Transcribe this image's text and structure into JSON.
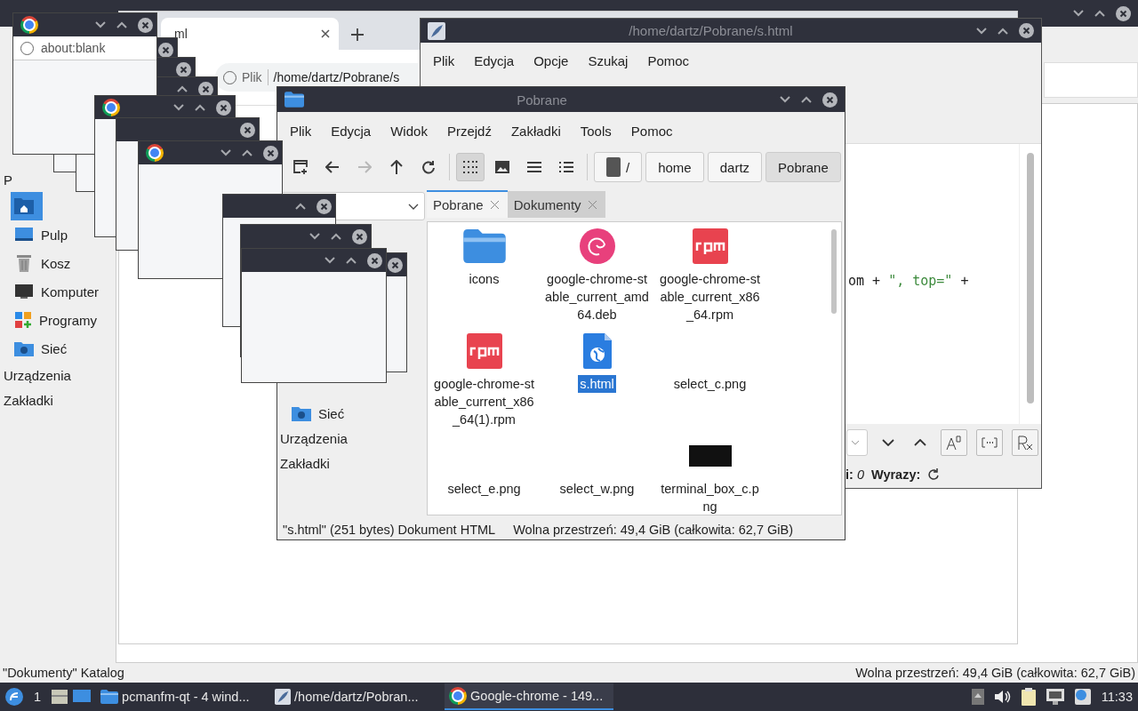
{
  "desktop_file_manager": {
    "sidebar": [
      {
        "kind": "heading",
        "label": "P"
      },
      {
        "kind": "place",
        "selected": true
      },
      {
        "kind": "place",
        "label": "Pulp",
        "selected": false
      },
      {
        "kind": "place",
        "label": "Kosz",
        "selected": false
      },
      {
        "kind": "place",
        "label": "Komputer",
        "selected": false
      },
      {
        "kind": "place",
        "label": "Programy",
        "selected": false
      },
      {
        "kind": "place",
        "label": "Sieć",
        "selected": false
      },
      {
        "kind": "heading",
        "label": "Urządzenia"
      },
      {
        "kind": "heading",
        "label": "Zakładki"
      }
    ],
    "status_left": "\"Dokumenty\" Katalog",
    "status_right": "Wolna przestrzeń: 49,4 GiB (całkowita: 62,7 GiB)"
  },
  "browser_window": {
    "tab_title": "ml",
    "address_scheme": "Plik",
    "address_path": "/home/dartz/Pobrane/s"
  },
  "blank_browser_window": {
    "address": "about:blank"
  },
  "editor_window": {
    "title": "/home/dartz/Pobrane/s.html",
    "menu": [
      "Plik",
      "Edycja",
      "Opcje",
      "Szukaj",
      "Pomoc"
    ],
    "code_tokens": [
      {
        "kind": "plain",
        "text": "om + "
      },
      {
        "kind": "string",
        "text": "\", top=\""
      },
      {
        "kind": "plain",
        "text": " +"
      }
    ],
    "status": [
      {
        "label": "i:",
        "value": "0"
      },
      {
        "label": "Wyrazy:"
      }
    ]
  },
  "file_manager_window": {
    "title": "Pobrane",
    "menu": [
      "Plik",
      "Edycja",
      "Widok",
      "Przejdź",
      "Zakładki",
      "Tools",
      "Pomoc"
    ],
    "toolbar": [
      {
        "selected": false,
        "disabled": false
      },
      {
        "selected": false,
        "disabled": false
      },
      {
        "selected": false,
        "disabled": true
      },
      {
        "selected": false,
        "disabled": false
      },
      {
        "selected": false,
        "disabled": false
      },
      {
        "selected": true,
        "disabled": false
      },
      {
        "selected": false,
        "disabled": false
      },
      {
        "selected": false,
        "disabled": false
      },
      {
        "selected": false,
        "disabled": false
      }
    ],
    "path": [
      {
        "label": "/",
        "selected": false
      },
      {
        "label": "home",
        "selected": false
      },
      {
        "label": "dartz",
        "selected": false
      },
      {
        "label": "Pobrane",
        "selected": true
      }
    ],
    "sidebar": [
      {
        "kind": "place",
        "label": "Sieć"
      },
      {
        "kind": "heading",
        "label": "Urządzenia"
      },
      {
        "kind": "heading",
        "label": "Zakładki"
      }
    ],
    "tabs": [
      {
        "label": "Pobrane",
        "selected": true
      },
      {
        "label": "Dokumenty",
        "selected": false
      }
    ],
    "files": [
      {
        "kind": "folder",
        "name": "icons",
        "selected": false
      },
      {
        "kind": "deb",
        "name": "google-chrome-stable_current_amd64.deb",
        "selected": false
      },
      {
        "kind": "rpm",
        "name": "google-chrome-stable_current_x86_64.rpm",
        "selected": false
      },
      {
        "kind": "rpm",
        "name": "google-chrome-stable_current_x86_64(1).rpm",
        "selected": false
      },
      {
        "kind": "html",
        "name": "s.html",
        "selected": true
      },
      {
        "kind": "none",
        "name": "select_c.png",
        "selected": false
      },
      {
        "kind": "none",
        "name": "select_e.png",
        "selected": false
      },
      {
        "kind": "none",
        "name": "select_w.png",
        "selected": false
      },
      {
        "kind": "dark",
        "name": "terminal_box_c.png",
        "selected": false
      }
    ],
    "status_left": "\"s.html\" (251 bytes) Dokument HTML",
    "status_right": "Wolna przestrzeń: 49,4 GiB (całkowita: 62,7 GiB)"
  },
  "taskbar": {
    "workspace": "1",
    "tasks": [
      {
        "label": "pcmanfm-qt - 4 wind...",
        "selected": false
      },
      {
        "label": "/home/dartz/Pobran...",
        "selected": false
      },
      {
        "label": "Google-chrome - 149...",
        "selected": true
      }
    ],
    "clock": "11:33"
  }
}
